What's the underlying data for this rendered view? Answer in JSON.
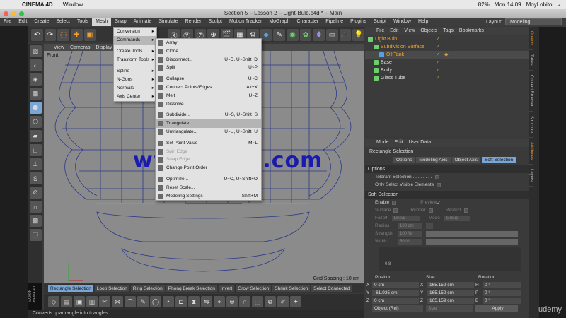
{
  "mac": {
    "app": "CINEMA 4D",
    "window": "Window",
    "battery": "82%",
    "time": "Mon 14:09",
    "user": "MoyLobito"
  },
  "title": "Section 5 – Lesson 2 – Light-Bulb.c4d * – Main",
  "menu": [
    "File",
    "Edit",
    "Create",
    "Select",
    "Tools",
    "Mesh",
    "Snap",
    "Animate",
    "Simulate",
    "Render",
    "Sculpt",
    "Motion Tracker",
    "MoGraph",
    "Character",
    "Pipeline",
    "Plugins",
    "Script",
    "Window",
    "Help"
  ],
  "layout": {
    "label": "Layout:",
    "value": "Modeling"
  },
  "viewport": {
    "menu": [
      "View",
      "Cameras",
      "Display"
    ],
    "label": "Front",
    "grid": "Grid Spacing : 10 cm"
  },
  "watermark": "www.cgtsj.com",
  "mesh_menu": [
    "Conversion",
    "Commands",
    "",
    "Create Tools",
    "Transform Tools",
    "",
    "Spline",
    "N-Gons",
    "Normals",
    "Axis Center"
  ],
  "commands": [
    {
      "label": "Array",
      "sc": ""
    },
    {
      "label": "Clone",
      "sc": ""
    },
    {
      "label": "Disconnect...",
      "sc": "U~D, U~Shift+D"
    },
    {
      "label": "Split",
      "sc": "U~P"
    },
    {
      "label": "",
      "sc": ""
    },
    {
      "label": "Collapse",
      "sc": "U~C"
    },
    {
      "label": "Connect Points/Edges",
      "sc": "Alt+X"
    },
    {
      "label": "Melt",
      "sc": "U~Z"
    },
    {
      "label": "Dissolve",
      "sc": ""
    },
    {
      "label": "",
      "sc": ""
    },
    {
      "label": "Subdivide...",
      "sc": "U~S, U~Shift+S"
    },
    {
      "label": "Triangulate",
      "sc": ""
    },
    {
      "label": "Untriangulate...",
      "sc": "U~U, U~Shift+U"
    },
    {
      "label": "",
      "sc": ""
    },
    {
      "label": "Set Point Value",
      "sc": "M~L"
    },
    {
      "label": "Spin Edge",
      "sc": ""
    },
    {
      "label": "Swap Edge",
      "sc": ""
    },
    {
      "label": "Change Point Order",
      "sc": ""
    },
    {
      "label": "",
      "sc": ""
    },
    {
      "label": "Optimize...",
      "sc": "U~O, U~Shift+O"
    },
    {
      "label": "Reset Scale...",
      "sc": ""
    },
    {
      "label": "Modeling Settings",
      "sc": "Shift+M"
    }
  ],
  "objects": {
    "menu": [
      "File",
      "Edit",
      "View",
      "Objects",
      "Tags",
      "Bookmarks"
    ],
    "items": [
      {
        "name": "Light Bulb",
        "color": "#f3a322"
      },
      {
        "name": "Subdivision Surface",
        "color": "#f3a322"
      },
      {
        "name": "Oil Tank",
        "color": "#f3a322"
      },
      {
        "name": "Base",
        "color": "#dddddd"
      },
      {
        "name": "Body",
        "color": "#dddddd"
      },
      {
        "name": "Glass Tube",
        "color": "#dddddd"
      }
    ]
  },
  "attributes": {
    "menu": [
      "Mode",
      "Edit",
      "User Data"
    ],
    "title": "Rectangle Selection",
    "tabs": [
      "Options",
      "Modeling Axis",
      "Object Axis",
      "Soft Selection"
    ],
    "options_header": "Options",
    "opt1": "Tolerant Selection . . . . . . . .",
    "opt2": "Only Select Visible Elements",
    "soft_header": "Soft Selection",
    "enable": "Enable",
    "preview": "Preview",
    "surface": "Surface",
    "rubber": "Rubber",
    "restrict": "Restrict",
    "falloff": "Falloff",
    "falloff_val": "Linear",
    "mode": "Mode",
    "mode_val": "Group",
    "radius": "Radius",
    "radius_val": "100 cm",
    "strength": "Strength",
    "strength_val": "100 %",
    "width": "Width",
    "width_val": "50 %",
    "graph_label": "0.8"
  },
  "coords": {
    "headers": [
      "Position",
      "Size",
      "Rotation"
    ],
    "x": [
      "X",
      "0 cm",
      "X",
      "165.159 cm",
      "H",
      "0 °"
    ],
    "y": [
      "Y",
      "-61.935 cm",
      "Y",
      "165.159 cm",
      "P",
      "0 °"
    ],
    "z": [
      "Z",
      "0 cm",
      "Z",
      "165.159 cm",
      "B",
      "0 °"
    ],
    "mode": "Object (Rel)",
    "size_mode": "Size",
    "apply": "Apply"
  },
  "right_tabs": [
    "Objects",
    "Takes",
    "Content Browser",
    "Structure",
    "Attributes",
    "Layers"
  ],
  "bottom_tabs": [
    "Rectangle Selection",
    "Loop Selection",
    "Ring Selection",
    "Phong Break Selection",
    "Invert",
    "Grow Selection",
    "Shrink Selection",
    "Select Connected"
  ],
  "status": "Converts quadrangle into triangles",
  "udemy": "udemy",
  "maxon": "MAXON CINEMA 4D"
}
